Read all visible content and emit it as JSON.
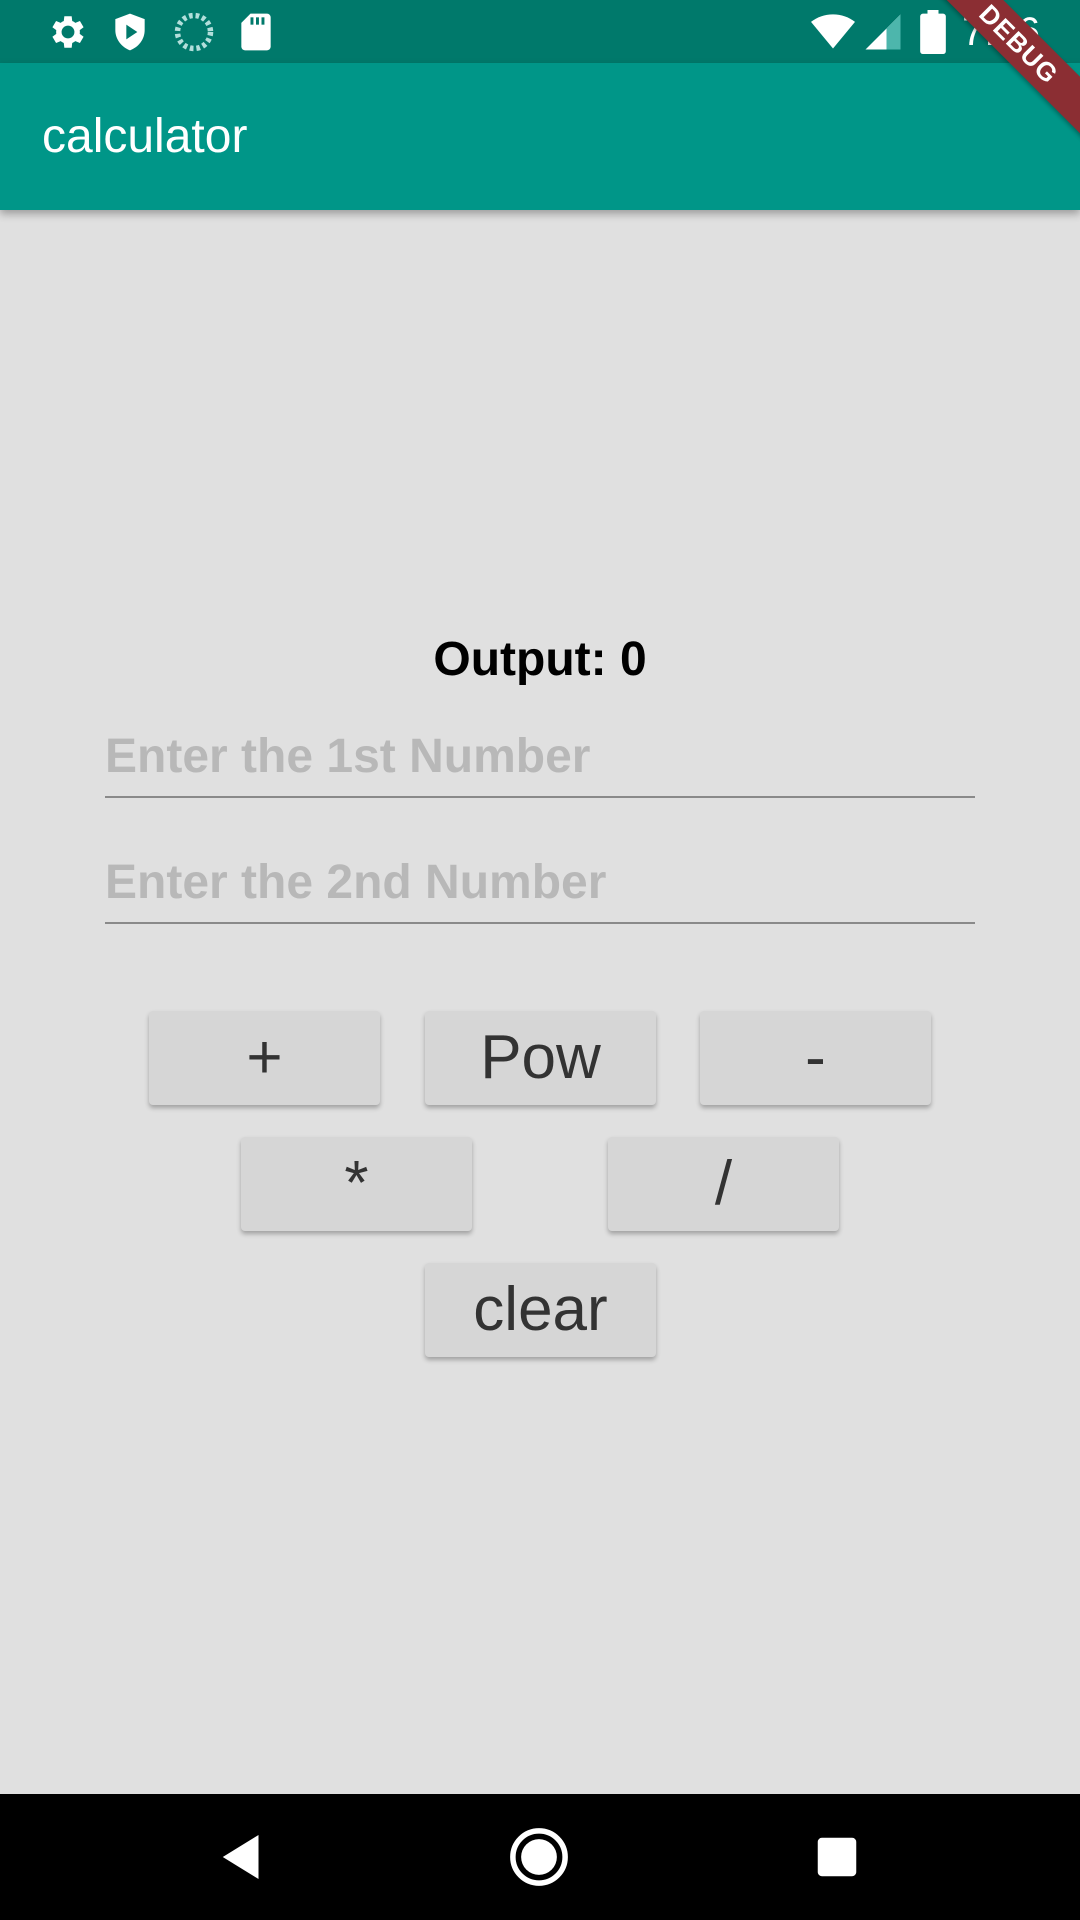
{
  "status_bar": {
    "time": "7:26",
    "left_icons": [
      "settings-icon",
      "shield-icon",
      "sync-icon",
      "sd-card-icon"
    ],
    "right_icons": [
      "wifi-icon",
      "signal-icon",
      "battery-icon"
    ]
  },
  "app_bar": {
    "title": "calculator",
    "debug_label": "DEBUG",
    "color": "#009688"
  },
  "main": {
    "output_text": "Output: 0",
    "input1": {
      "placeholder": "Enter the 1st Number",
      "value": ""
    },
    "input2": {
      "placeholder": "Enter the 2nd Number",
      "value": ""
    },
    "buttons": {
      "add": "+",
      "pow": "Pow",
      "subtract": "-",
      "multiply": "*",
      "divide": "/",
      "clear": "clear"
    }
  },
  "nav_bar": {
    "icons": [
      "back-icon",
      "home-icon",
      "recents-icon"
    ]
  }
}
